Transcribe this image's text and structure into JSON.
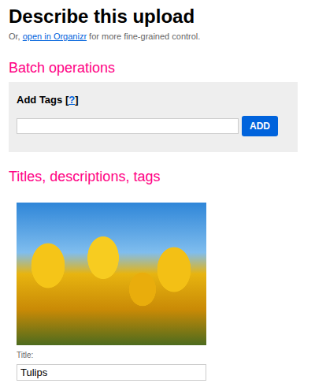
{
  "page": {
    "title": "Describe this upload",
    "intro_before": "Or, ",
    "intro_link": "open in Organizr",
    "intro_after": " for more fine-grained control."
  },
  "batch": {
    "heading": "Batch operations",
    "add_tags_label": "Add Tags",
    "help_open": "[",
    "help_link": "?",
    "help_close": "]",
    "tags_value": "",
    "button": "ADD"
  },
  "items_section": {
    "heading": "Titles, descriptions, tags"
  },
  "uploads": [
    {
      "title_label": "Title:",
      "title": "Tulips"
    }
  ]
}
